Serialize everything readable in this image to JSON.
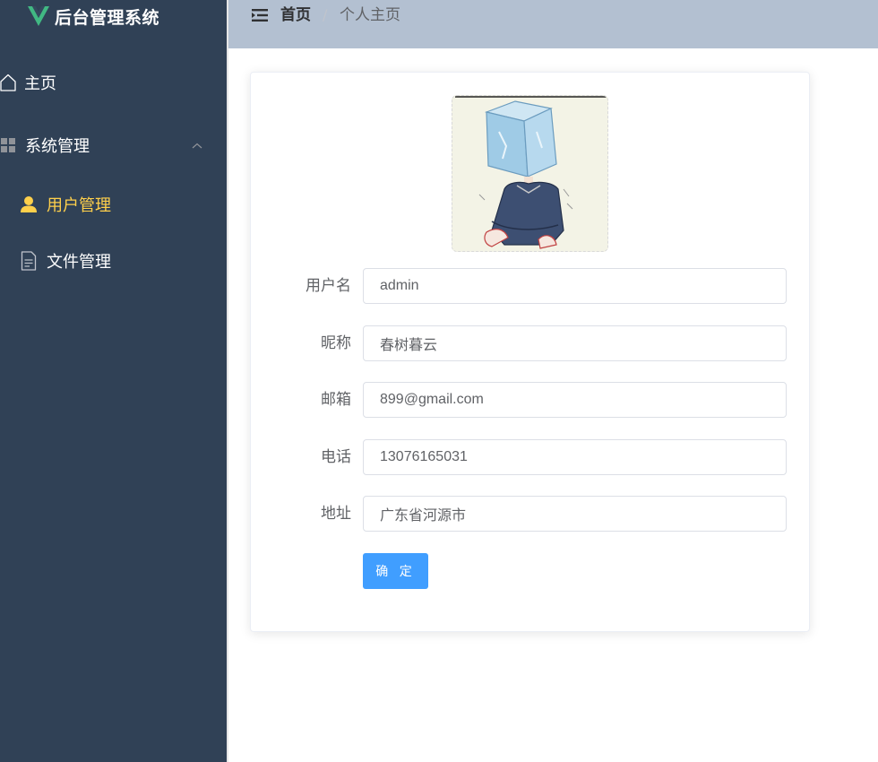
{
  "app": {
    "title": "后台管理系统",
    "brand_color": "#41b883",
    "sidebar_bg": "#304156",
    "active_color": "#ffd04b"
  },
  "sidebar": {
    "items": [
      {
        "label": "主页",
        "icon": "home-icon"
      },
      {
        "label": "系统管理",
        "icon": "grid-icon",
        "expanded": true
      },
      {
        "label": "用户管理",
        "icon": "user-icon",
        "active": true
      },
      {
        "label": "文件管理",
        "icon": "document-icon"
      }
    ]
  },
  "header": {
    "breadcrumb_home": "首页",
    "breadcrumb_separator": "/",
    "breadcrumb_current": "个人主页"
  },
  "profile": {
    "avatar_icon": "avatar-ice-cube-illustration",
    "fields": [
      {
        "label": "用户名",
        "value": "admin"
      },
      {
        "label": "昵称",
        "value": "春树暮云"
      },
      {
        "label": "邮箱",
        "value": "899@gmail.com"
      },
      {
        "label": "电话",
        "value": "13076165031"
      },
      {
        "label": "地址",
        "value": "广东省河源市"
      }
    ],
    "confirm_label": "确 定",
    "primary_color": "#409eff"
  }
}
